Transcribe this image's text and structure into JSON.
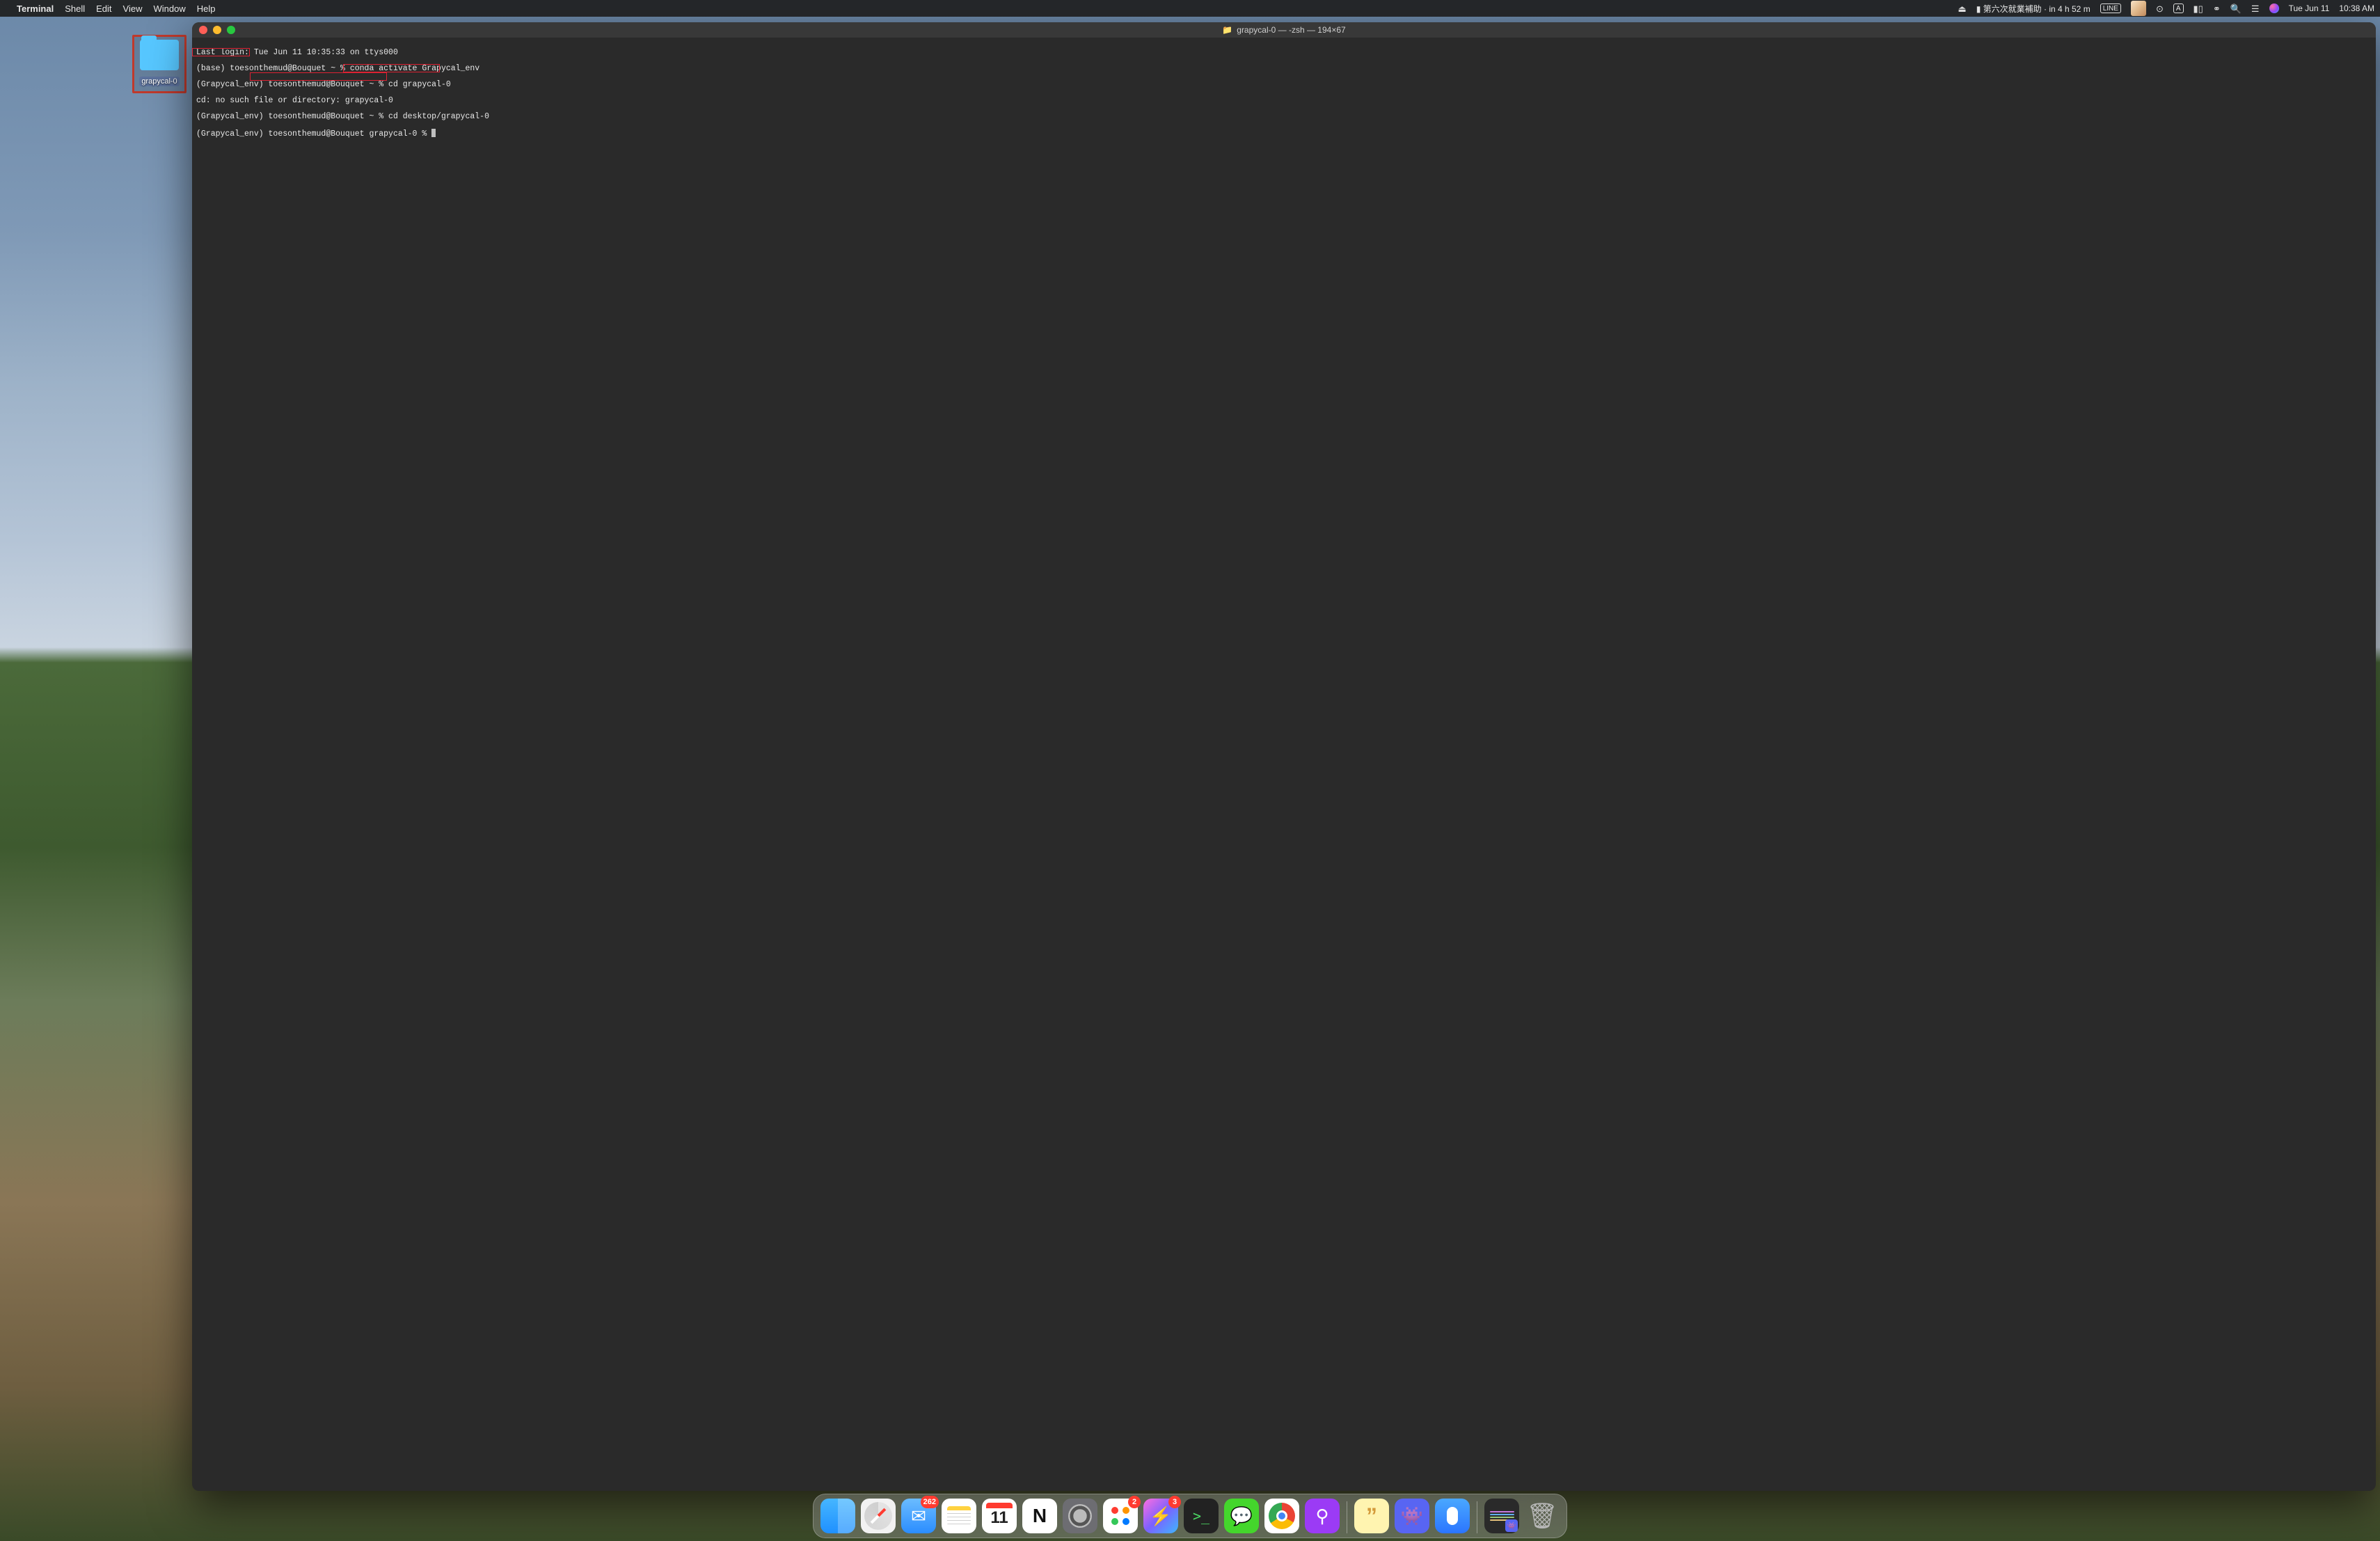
{
  "menubar": {
    "app_name": "Terminal",
    "menus": [
      "Shell",
      "Edit",
      "View",
      "Window",
      "Help"
    ],
    "status_text": "第六次就業補助 · in 4 h 52 m",
    "date": "Tue Jun 11",
    "time": "10:38 AM",
    "input_mode": "A",
    "line_app": "LINE"
  },
  "desktop": {
    "folder_name": "grapycal-0"
  },
  "terminal": {
    "title": "grapycal-0 — -zsh — 194×67",
    "lines": {
      "l1": "Last login: Tue Jun 11 10:35:33 on ttys000",
      "l2": "(base) toesonthemud@Bouquet ~ % conda activate Grapycal_env",
      "l3": "(Grapycal_env) toesonthemud@Bouquet ~ % cd grapycal-0",
      "l4": "cd: no such file or directory: grapycal-0",
      "l5": "(Grapycal_env) toesonthemud@Bouquet ~ % cd desktop/grapycal-0",
      "l6": "(Grapycal_env) toesonthemud@Bouquet grapycal-0 % "
    }
  },
  "dock": {
    "calendar_day": "11",
    "badges": {
      "mail": "262",
      "reminders": "2",
      "messenger": "3"
    },
    "apps": {
      "finder": "Finder",
      "safari": "Safari",
      "mail": "Mail",
      "notes": "Notes",
      "calendar": "Calendar",
      "notion": "Notion",
      "settings": "System Settings",
      "reminders": "Reminders",
      "messenger": "Messenger",
      "terminal": "Terminal",
      "line": "LINE",
      "chrome": "Google Chrome",
      "podcasts": "Podcasts",
      "stickies": "Stickies",
      "discord": "Discord",
      "voice": "Voice Memos",
      "recent": "Recent Apps",
      "trash": "Trash"
    }
  }
}
